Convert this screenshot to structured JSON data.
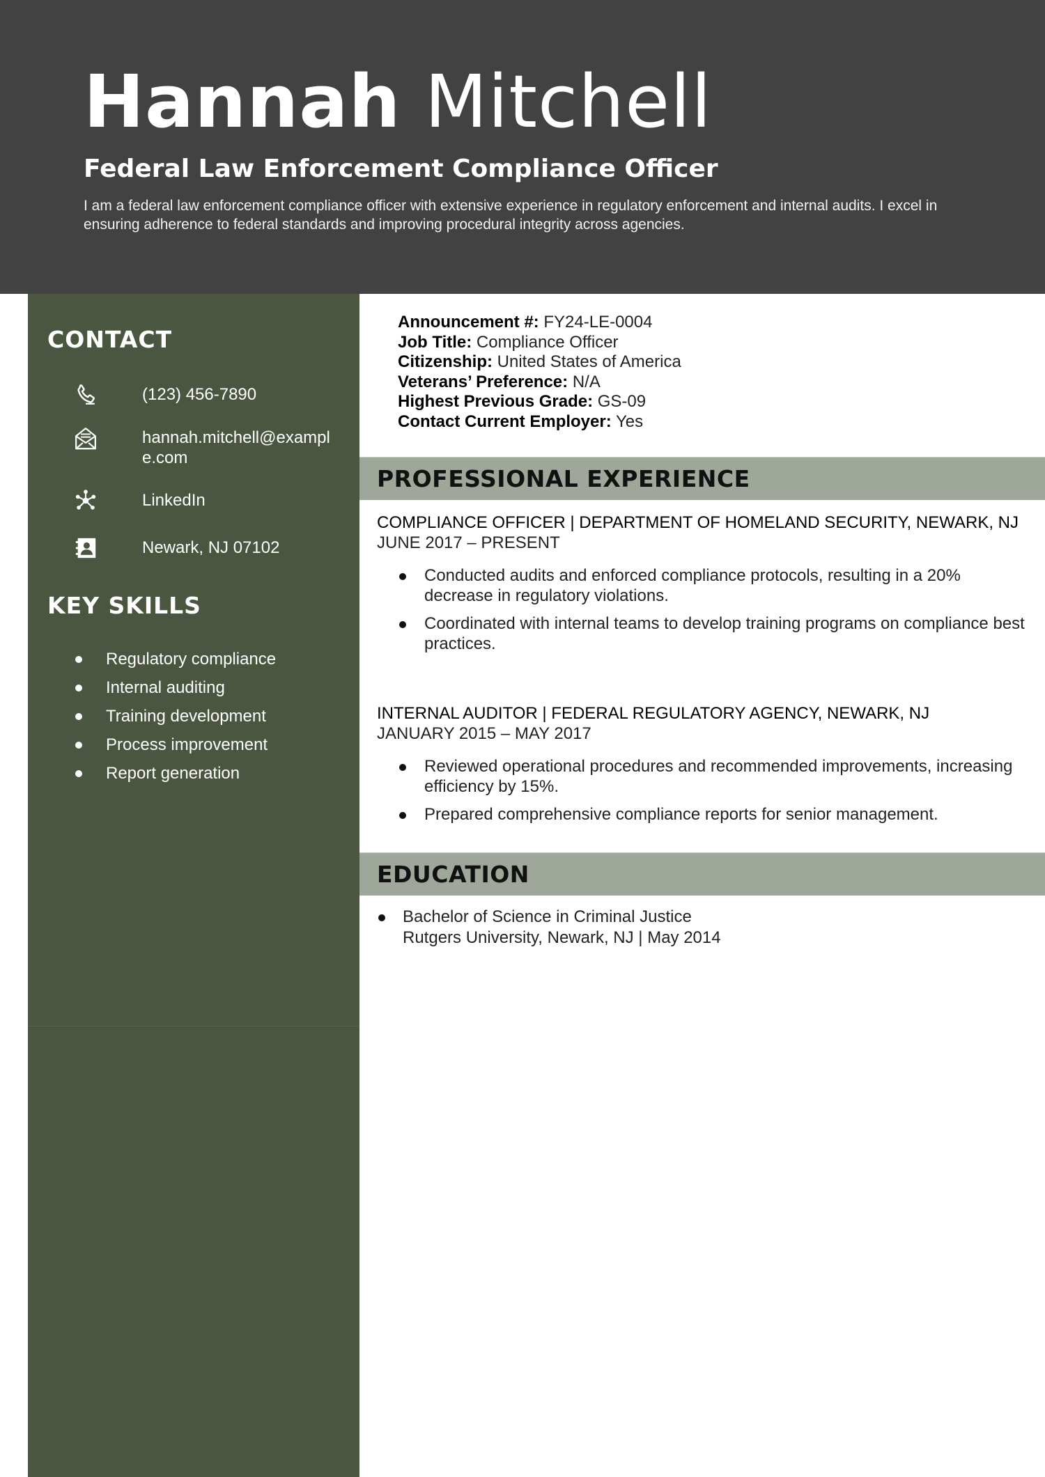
{
  "header": {
    "first_name": "Hannah",
    "last_name": "Mitchell",
    "headline": "Federal Law Enforcement Compliance Officer",
    "summary": "I am a federal law enforcement compliance officer with extensive experience in regulatory enforcement and internal audits. I excel in ensuring adherence to federal standards and improving procedural integrity across agencies."
  },
  "sidebar": {
    "contact_heading": "CONTACT",
    "contact": {
      "phone": {
        "icon": "phone-icon",
        "text": "(123) 456-7890"
      },
      "email": {
        "icon": "envelope-icon",
        "text": "hannah.mitchell@example.com"
      },
      "linkedin": {
        "icon": "network-icon",
        "text": "LinkedIn"
      },
      "address": {
        "icon": "contact-card-icon",
        "text": "Newark, NJ 07102"
      }
    },
    "skills_heading": "KEY SKILLS",
    "skills": [
      "Regulatory compliance",
      "Internal auditing",
      "Training development",
      "Process improvement",
      "Report generation"
    ]
  },
  "info": [
    {
      "label": "Announcement #:",
      "value": "FY24-LE-0004"
    },
    {
      "label": "Job Title:",
      "value": "Compliance Officer"
    },
    {
      "label": "Citizenship:",
      "value": "United States of America"
    },
    {
      "label": "Veterans’ Preference:",
      "value": "N/A"
    },
    {
      "label": "Highest Previous Grade:",
      "value": "GS-09"
    },
    {
      "label": "Contact Current Employer:",
      "value": "Yes"
    }
  ],
  "experience": {
    "heading": "PROFESSIONAL EXPERIENCE",
    "jobs": [
      {
        "title": "COMPLIANCE OFFICER | DEPARTMENT OF HOMELAND SECURITY, NEWARK, NJ",
        "dates": "JUNE 2017 – PRESENT",
        "bullets": [
          "Conducted audits and enforced compliance protocols, resulting in a 20% decrease in regulatory violations.",
          "Coordinated with internal teams to develop training programs on compliance best practices."
        ]
      },
      {
        "title": "INTERNAL AUDITOR | FEDERAL REGULATORY AGENCY, NEWARK, NJ",
        "dates": "JANUARY 2015 – MAY 2017",
        "bullets": [
          "Reviewed operational procedures and recommended improvements, increasing efficiency by 15%.",
          "Prepared comprehensive compliance reports for senior management."
        ]
      }
    ]
  },
  "education": {
    "heading": "EDUCATION",
    "degree": "Bachelor of Science in Criminal Justice",
    "school": "Rutgers University, Newark, NJ | May 2014"
  },
  "colors": {
    "header_bg": "#424242",
    "sidebar_bg": "#4a5640",
    "section_bar_bg": "#9ea79a"
  }
}
